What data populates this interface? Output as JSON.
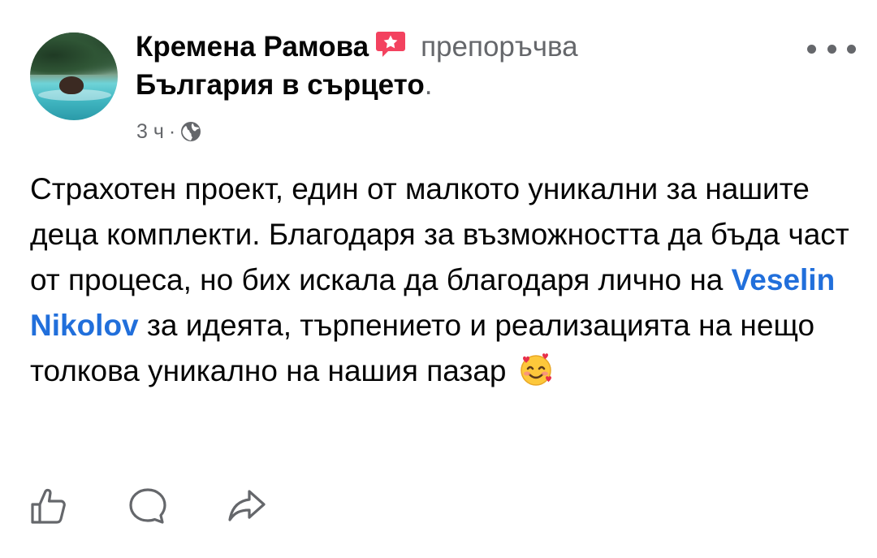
{
  "post": {
    "author": "Кремена Рамова",
    "action": "препоръчва",
    "page_name": "България в сърцето",
    "period": ".",
    "time": "3 ч",
    "time_separator": "·",
    "privacy_icon": "globe-icon",
    "recommend_icon": "flag-icon",
    "body_before_mention": "Страхотен проект, един от малкото уникални за нашите деца комплекти. Благодаря за възможността да бъда част от процеса, но бих искала да благодаря лично на ",
    "mention": "Veselin Nikolov",
    "body_after_mention": " за идеята, търпението и реализацията на нещо толкова уникално на нашия пазар ",
    "emoji": "smiling-face-with-hearts-icon"
  },
  "actions": [
    {
      "name": "like",
      "icon": "thumbs-up-icon"
    },
    {
      "name": "comment",
      "icon": "comment-icon"
    },
    {
      "name": "share",
      "icon": "share-icon"
    }
  ],
  "colors": {
    "text_primary": "#050505",
    "text_secondary": "#65676b",
    "mention": "#216fdb",
    "recommend_badge": "#f3425f"
  }
}
